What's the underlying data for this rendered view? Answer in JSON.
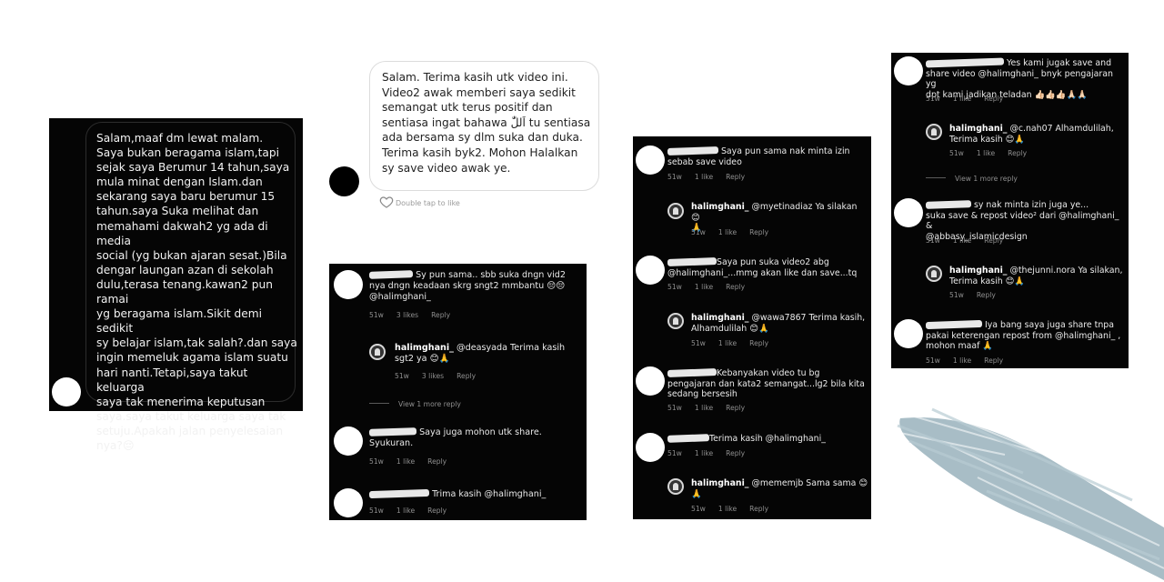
{
  "dm_dark": {
    "message": "Salam,maaf dm lewat malam.\nSaya bukan beragama islam,tapi\nsejak saya Berumur 14 tahun,saya\nmula minat dengan Islam.dan\nsekarang saya baru berumur 15\ntahun.saya Suka melihat dan\nmemahami dakwah2 yg ada di media\nsocial (yg bukan ajaran sesat.)Bila\ndengar laungan azan di sekolah\ndulu,terasa tenang.kawan2 pun ramai\nyg beragama islam.Sikit demi sedikit\nsy belajar islam,tak salah?.dan saya\ningin memeluk agama islam suatu\nhari nanti.Tetapi,saya takut keluarga\nsaya tak menerima keputusan\nsaya.saya takut keluarga saya tak\nsetuju.Apakah jalan penyelesaian\nnya?😔"
  },
  "dm_light": {
    "message": "Salam. Terima kasih utk video ini.\nVideo2 awak memberi saya sedikit\nsemangat utk terus positif dan\nsentiasa ingat bahawa اَللّٰ tu sentiasa\nada bersama sy dlm suka dan duka.\nTerima kasih byk2. Mohon Halalkan\nsy save video awak ye.",
    "double_tap": "Double tap to like"
  },
  "panel3": {
    "c1": {
      "text": "Sy pun sama.. sbb suka dngn vid2\nnya dngn keadaan skrg sngt2 mmbantu 😔😔\n@halimghani_",
      "age": "51w",
      "likes": "3 likes",
      "reply": "Reply"
    },
    "r1": {
      "user": "halimghani_",
      "text": " @deasyada Terima kasih\nsgt2 ya 😊🙏",
      "age": "51w",
      "likes": "3 likes",
      "reply": "Reply"
    },
    "view_more": "View 1 more reply",
    "c2": {
      "text": "Saya juga mohon utk share.\nSyukuran.",
      "age": "51w",
      "likes": "1 like",
      "reply": "Reply"
    },
    "c3": {
      "text": "Trima kasih @halimghani_",
      "age": "51w",
      "likes": "1 like",
      "reply": "Reply"
    }
  },
  "panel4": {
    "c1": {
      "text": "Saya pun sama nak minta izin\nsebab save video",
      "age": "51w",
      "likes": "1 like",
      "reply": "Reply"
    },
    "r1": {
      "user": "halimghani_",
      "text": " @myetinadiaz Ya silakan 😊\n🙏",
      "age": "51w",
      "likes": "1 like",
      "reply": "Reply"
    },
    "c2": {
      "text": "Saya pun suka video2 abg\n@halimghani_...mmg akan like dan save...tq",
      "age": "51w",
      "likes": "1 like",
      "reply": "Reply"
    },
    "r2": {
      "user": "halimghani_",
      "text": " @wawa7867 Terima kasih,\nAlhamdulilah 😊🙏",
      "age": "51w",
      "likes": "1 like",
      "reply": "Reply"
    },
    "c3": {
      "text": "Kebanyakan video tu bg\npengajaran dan kata2 semangat...lg2 bila kita\nsedang bersesih",
      "age": "51w",
      "likes": "1 like",
      "reply": "Reply"
    },
    "c4": {
      "text": "Terima kasih @halimghani_",
      "age": "51w",
      "likes": "1 like",
      "reply": "Reply"
    },
    "r3": {
      "user": "halimghani_",
      "text": " @mememjb Sama sama 😊\n🙏",
      "age": "51w",
      "likes": "1 like",
      "reply": "Reply"
    }
  },
  "panel5": {
    "c1": {
      "text": "Yes kami jugak save and\nshare video @halimghani_ bnyk pengajaran yg\ndpt kami jadikan teladan 👍🏻👍🏻👍🏻🙏🏻🙏🏻",
      "age": "51w",
      "likes": "1 like",
      "reply": "Reply"
    },
    "r1": {
      "user": "halimghani_",
      "text": " @c.nah07 Alhamdulilah,\nTerima kasih 😊🙏",
      "age": "51w",
      "likes": "1 like",
      "reply": "Reply"
    },
    "view_more": "View 1 more reply",
    "c2": {
      "text": "sy nak minta izin juga ye...\nsuka save & repost video² dari @halimghani_ &\n@abbasy_islamicdesign",
      "age": "51w",
      "likes": "1 like",
      "reply": "Reply"
    },
    "r2": {
      "user": "halimghani_",
      "text": " @thejunni.nora Ya silakan,\nTerima kasih 😊🙏",
      "age": "51w",
      "reply": "Reply"
    },
    "c3": {
      "text": "Iya bang saya juga share tnpa\npakai keterengan repost from @halimghani_ ,\nmohon maaf 🙏",
      "age": "51w",
      "likes": "1 like",
      "reply": "Reply"
    }
  },
  "colors": {
    "panel_bg": "#050505",
    "meta": "#8e8e8e",
    "brush": "#9fb6c0"
  },
  "icons": [
    "heart-icon",
    "brush-stroke-decoration"
  ]
}
